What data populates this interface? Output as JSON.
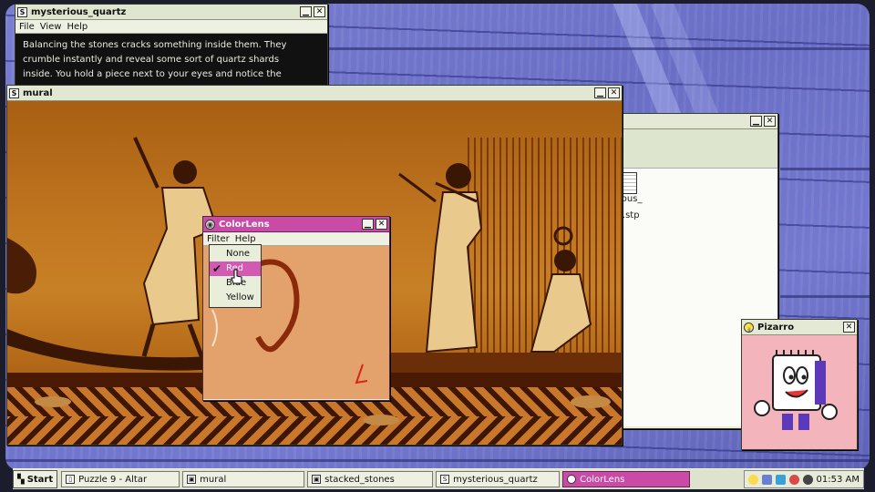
{
  "desktop": {
    "wallpaper": "purple wooden planks"
  },
  "windows": {
    "quartz": {
      "title": "mysterious_quartz",
      "menu": [
        "File",
        "View",
        "Help"
      ],
      "lines": [
        "Balancing the stones cracks something inside them. They",
        "crumble instantly and reveal some sort of quartz shards",
        "inside. You hold a piece next to your eyes and notice the"
      ]
    },
    "back": {
      "files": [
        "ious_",
        "t.stp"
      ]
    },
    "mural": {
      "title": "mural"
    },
    "colorlens": {
      "title": "ColorLens",
      "menu": [
        "Filter",
        "Help"
      ],
      "filters": [
        "None",
        "Red",
        "Blue",
        "Yellow"
      ],
      "selected_filter": "Red",
      "accent_color": "#c94ba6"
    },
    "pizarro": {
      "title": "Pizarro"
    }
  },
  "taskbar": {
    "start": "Start",
    "tasks": [
      "Puzzle 9 - Altar",
      "mural",
      "stacked_stones",
      "mysterious_quartz",
      "ColorLens"
    ],
    "active_task": "ColorLens",
    "clock": "01:53 AM"
  }
}
